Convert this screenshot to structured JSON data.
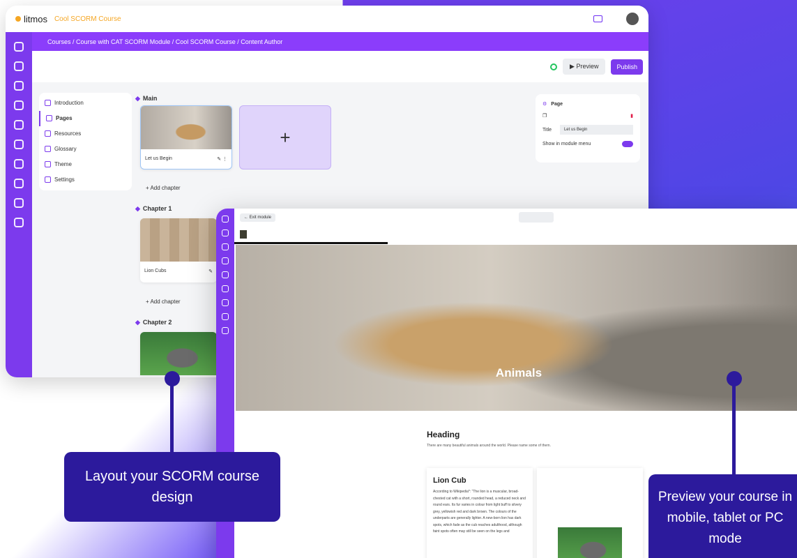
{
  "editor": {
    "logo": "litmos",
    "course_name": "Cool SCORM Course",
    "breadcrumb": "Courses  /  Course with CAT SCORM Module  /  Cool SCORM Course  /  Content Author",
    "preview_label": "Preview",
    "publish_label": "Publish",
    "menu": [
      "Introduction",
      "Pages",
      "Resources",
      "Glossary",
      "Theme",
      "Settings"
    ],
    "sections": {
      "main": "Main",
      "ch1": "Chapter 1",
      "ch2": "Chapter 2"
    },
    "cards": {
      "main": "Let us Begin",
      "ch1": "Lion Cubs"
    },
    "add_chapter": "+ Add chapter",
    "plus": "+",
    "props": {
      "header": "Page",
      "title_label": "Title",
      "title_value": "Let us Begin",
      "show_label": "Show in module menu"
    }
  },
  "preview": {
    "edit_module": "← Exit module",
    "hero_title": "Animals",
    "heading": "Heading",
    "subtext": "There are many beautiful animals around the world. Please name some of them.",
    "card_title": "Lion Cub",
    "card_text": "According to Wikipedia*: \"The lion is a muscular, broad-chested cat with a short, rounded head, a reduced neck and round ears. Its fur varies in colour from light buff to silvery grey, yellowish red and dark brown. The colours of the underparts are generally lighter. A new-born lion has dark spots, which fade as the cub reaches adulthood, although faint spots often may still be seen on the legs and"
  },
  "callouts": {
    "left": "Layout your SCORM course design",
    "right": "Preview your course in mobile, tablet or PC mode"
  },
  "colors": {
    "accent": "#7c3aed",
    "callout": "#2c1a9c"
  }
}
